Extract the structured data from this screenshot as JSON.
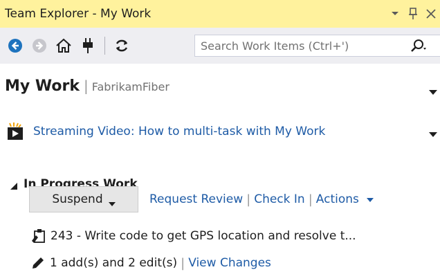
{
  "window": {
    "title": "Team Explorer - My Work",
    "buttons": [
      {
        "icon": "dropdown-arrow-icon"
      },
      {
        "icon": "pin-icon"
      },
      {
        "icon": "close-icon"
      }
    ]
  },
  "toolbar": {
    "buttons": [
      {
        "icon": "back-arrow-icon"
      },
      {
        "icon": "forward-arrow-icon"
      },
      {
        "icon": "home-icon"
      },
      {
        "icon": "connect-plug-icon"
      },
      {
        "icon": "refresh-icon"
      }
    ],
    "search": {
      "placeholder": "Search Work Items (Ctrl+')",
      "value": ""
    }
  },
  "header": {
    "title": "My Work",
    "separator": "|",
    "project": "FabrikamFiber"
  },
  "video": {
    "label": "Streaming Video: How to multi-task with My Work"
  },
  "in_progress": {
    "section_title": "In Progress Work",
    "suspend_label": "Suspend",
    "links": {
      "request_review": "Request Review",
      "check_in": "Check In",
      "actions": "Actions"
    },
    "work_item": "243 - Write code to get GPS location and resolve t...",
    "changes_text": "1 add(s) and 2 edit(s)",
    "view_changes": "View Changes"
  },
  "colors": {
    "titlebar_bg": "#fff29d",
    "toolbar_bg": "#eeeef2",
    "link": "#1e5ba6",
    "back_button": "#1e73be"
  }
}
